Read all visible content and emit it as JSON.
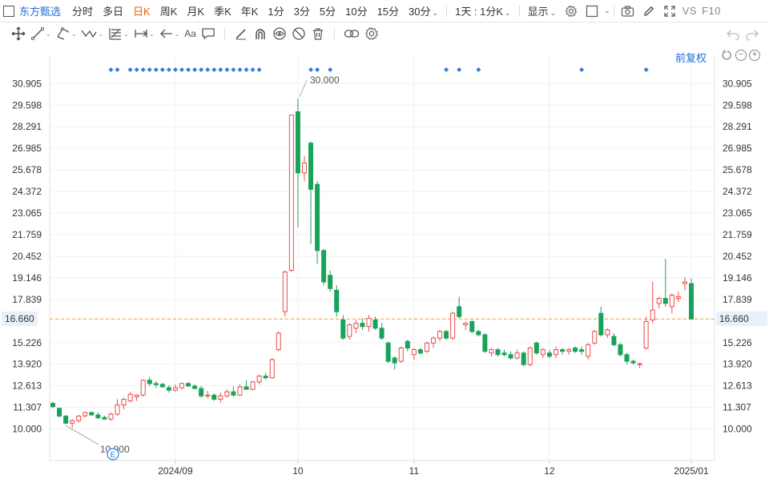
{
  "topbar": {
    "stock_name": "东方甄选",
    "periods": [
      "分时",
      "多日",
      "日K",
      "周K",
      "月K",
      "季K",
      "年K",
      "1分",
      "3分",
      "5分",
      "10分",
      "15分",
      "30分"
    ],
    "active_period": "日K",
    "multi_select": "1天 : 1分K",
    "display_label": "显示",
    "vs_label": "VS",
    "f10_label": "F10"
  },
  "toolbar": {
    "text_tool": "Aa",
    "icons": [
      "crosshair-move-icon",
      "line-tool-icon",
      "channel-tool-icon",
      "wave-tool-icon",
      "fib-tool-icon",
      "measure-tool-icon",
      "arrow-tool-icon",
      "text-tool-icon",
      "comment-tool-icon",
      "pen-tool-icon",
      "magnet-icon",
      "eye-icon",
      "hide-icon",
      "trash-icon",
      "link-icon",
      "settings-icon",
      "undo-icon",
      "redo-icon"
    ]
  },
  "chart_controls": {
    "adjust_label": "前复权"
  },
  "chart_data": {
    "type": "candlestick",
    "y_ticks": [
      "30.905",
      "29.598",
      "28.291",
      "26.985",
      "25.678",
      "24.372",
      "23.065",
      "21.759",
      "20.452",
      "19.146",
      "17.839",
      "16.660",
      "15.226",
      "13.920",
      "12.613",
      "11.307",
      "10.000"
    ],
    "ylim": [
      9.35,
      31.55
    ],
    "x_labels": [
      "2024/09",
      "10",
      "11",
      "12",
      "2025/01"
    ],
    "current_price": "16.660",
    "max_label": "30.000",
    "min_label": "10.900",
    "event_marker": "E",
    "colors": {
      "up": "#ee4b4b",
      "down": "#19a35a",
      "price_line": "#f2a13c",
      "dots": "#2f7ee5",
      "grid": "#f0f0f0"
    },
    "candles": [
      {
        "d": "2024-08-06",
        "o": 11.55,
        "h": 11.65,
        "l": 11.25,
        "c": 11.35
      },
      {
        "d": "2024-08-07",
        "o": 11.25,
        "h": 11.3,
        "l": 10.7,
        "c": 10.78
      },
      {
        "d": "2024-08-08",
        "o": 10.78,
        "h": 10.85,
        "l": 10.3,
        "c": 10.35
      },
      {
        "d": "2024-08-09",
        "o": 10.35,
        "h": 10.6,
        "l": 10.05,
        "c": 10.5
      },
      {
        "d": "2024-08-12",
        "o": 10.5,
        "h": 10.85,
        "l": 10.4,
        "c": 10.78
      },
      {
        "d": "2024-08-13",
        "o": 10.8,
        "h": 11.05,
        "l": 10.7,
        "c": 11.0
      },
      {
        "d": "2024-08-14",
        "o": 11.0,
        "h": 11.05,
        "l": 10.8,
        "c": 10.85
      },
      {
        "d": "2024-08-15",
        "o": 10.85,
        "h": 11.0,
        "l": 10.6,
        "c": 10.68
      },
      {
        "d": "2024-08-16",
        "o": 10.7,
        "h": 10.8,
        "l": 10.55,
        "c": 10.6
      },
      {
        "d": "2024-08-19",
        "o": 10.6,
        "h": 11.0,
        "l": 10.5,
        "c": 10.9
      },
      {
        "d": "2024-08-20",
        "o": 10.9,
        "h": 11.8,
        "l": 10.8,
        "c": 11.45
      },
      {
        "d": "2024-08-21",
        "o": 11.45,
        "h": 11.9,
        "l": 11.2,
        "c": 11.8
      },
      {
        "d": "2024-08-22",
        "o": 11.7,
        "h": 12.25,
        "l": 11.6,
        "c": 12.1
      },
      {
        "d": "2024-08-23",
        "o": 11.95,
        "h": 12.1,
        "l": 11.7,
        "c": 12.05
      },
      {
        "d": "2024-08-26",
        "o": 12.05,
        "h": 13.0,
        "l": 11.95,
        "c": 12.95
      },
      {
        "d": "2024-08-27",
        "o": 12.95,
        "h": 13.15,
        "l": 12.6,
        "c": 12.75
      },
      {
        "d": "2024-08-28",
        "o": 12.75,
        "h": 12.9,
        "l": 12.5,
        "c": 12.68
      },
      {
        "d": "2024-08-29",
        "o": 12.7,
        "h": 12.8,
        "l": 12.5,
        "c": 12.55
      },
      {
        "d": "2024-08-30",
        "o": 12.5,
        "h": 12.65,
        "l": 12.2,
        "c": 12.35
      },
      {
        "d": "2024-09-02",
        "o": 12.35,
        "h": 12.7,
        "l": 12.25,
        "c": 12.5
      },
      {
        "d": "2024-09-03",
        "o": 12.5,
        "h": 12.8,
        "l": 12.4,
        "c": 12.75
      },
      {
        "d": "2024-09-04",
        "o": 12.75,
        "h": 12.85,
        "l": 12.55,
        "c": 12.6
      },
      {
        "d": "2024-09-05",
        "o": 12.6,
        "h": 12.7,
        "l": 12.4,
        "c": 12.45
      },
      {
        "d": "2024-09-06",
        "o": 12.45,
        "h": 12.6,
        "l": 11.9,
        "c": 12.0
      },
      {
        "d": "2024-09-09",
        "o": 12.0,
        "h": 12.3,
        "l": 11.85,
        "c": 12.05
      },
      {
        "d": "2024-09-10",
        "o": 12.05,
        "h": 12.15,
        "l": 11.7,
        "c": 11.8
      },
      {
        "d": "2024-09-11",
        "o": 11.8,
        "h": 12.2,
        "l": 11.6,
        "c": 12.0
      },
      {
        "d": "2024-09-12",
        "o": 12.0,
        "h": 12.4,
        "l": 11.9,
        "c": 12.25
      },
      {
        "d": "2024-09-13",
        "o": 12.25,
        "h": 12.6,
        "l": 11.95,
        "c": 12.05
      },
      {
        "d": "2024-09-18",
        "o": 12.05,
        "h": 12.7,
        "l": 12.0,
        "c": 12.55
      },
      {
        "d": "2024-09-19",
        "o": 12.55,
        "h": 12.95,
        "l": 12.45,
        "c": 12.4
      },
      {
        "d": "2024-09-20",
        "o": 12.4,
        "h": 12.9,
        "l": 12.35,
        "c": 12.85
      },
      {
        "d": "2024-09-23",
        "o": 12.85,
        "h": 13.3,
        "l": 12.7,
        "c": 13.2
      },
      {
        "d": "2024-09-24",
        "o": 13.2,
        "h": 13.4,
        "l": 13.0,
        "c": 13.1
      },
      {
        "d": "2024-09-25",
        "o": 13.1,
        "h": 14.3,
        "l": 13.05,
        "c": 14.2
      },
      {
        "d": "2024-09-26",
        "o": 14.8,
        "h": 15.9,
        "l": 14.7,
        "c": 15.8
      },
      {
        "d": "2024-09-27",
        "o": 17.1,
        "h": 19.6,
        "l": 16.8,
        "c": 19.5
      },
      {
        "d": "2024-09-30",
        "o": 19.6,
        "h": 29.0,
        "l": 19.5,
        "c": 29.0
      },
      {
        "d": "2024-10-08",
        "o": 29.2,
        "h": 30.0,
        "l": 22.2,
        "c": 25.5
      },
      {
        "d": "2024-10-09",
        "o": 25.5,
        "h": 26.5,
        "l": 25.0,
        "c": 26.1
      },
      {
        "d": "2024-10-10",
        "o": 27.3,
        "h": 27.4,
        "l": 21.2,
        "c": 24.5
      },
      {
        "d": "2024-10-11",
        "o": 24.8,
        "h": 25.0,
        "l": 20.0,
        "c": 20.8
      },
      {
        "d": "2024-10-14",
        "o": 20.8,
        "h": 20.9,
        "l": 18.7,
        "c": 18.9
      },
      {
        "d": "2024-10-15",
        "o": 19.3,
        "h": 19.6,
        "l": 18.3,
        "c": 18.5
      },
      {
        "d": "2024-10-16",
        "o": 18.4,
        "h": 18.7,
        "l": 16.8,
        "c": 17.1
      },
      {
        "d": "2024-10-17",
        "o": 16.6,
        "h": 16.9,
        "l": 15.4,
        "c": 15.5
      },
      {
        "d": "2024-10-18",
        "o": 15.6,
        "h": 16.4,
        "l": 15.4,
        "c": 16.3
      },
      {
        "d": "2024-10-21",
        "o": 16.1,
        "h": 16.6,
        "l": 15.8,
        "c": 16.4
      },
      {
        "d": "2024-10-22",
        "o": 16.4,
        "h": 16.7,
        "l": 16.0,
        "c": 16.2
      },
      {
        "d": "2024-10-23",
        "o": 16.2,
        "h": 16.9,
        "l": 15.9,
        "c": 16.7
      },
      {
        "d": "2024-10-24",
        "o": 16.6,
        "h": 16.8,
        "l": 16.0,
        "c": 16.1
      },
      {
        "d": "2024-10-25",
        "o": 16.1,
        "h": 16.4,
        "l": 15.4,
        "c": 15.5
      },
      {
        "d": "2024-10-28",
        "o": 15.2,
        "h": 15.3,
        "l": 14.0,
        "c": 14.1
      },
      {
        "d": "2024-10-29",
        "o": 14.3,
        "h": 14.4,
        "l": 13.6,
        "c": 14.0
      },
      {
        "d": "2024-10-30",
        "o": 14.1,
        "h": 15.0,
        "l": 14.0,
        "c": 14.9
      },
      {
        "d": "2024-10-31",
        "o": 15.3,
        "h": 15.4,
        "l": 14.7,
        "c": 14.9
      },
      {
        "d": "2024-11-01",
        "o": 14.5,
        "h": 14.9,
        "l": 14.2,
        "c": 14.8
      },
      {
        "d": "2024-11-04",
        "o": 14.8,
        "h": 14.9,
        "l": 14.5,
        "c": 14.6
      },
      {
        "d": "2024-11-05",
        "o": 14.7,
        "h": 15.3,
        "l": 14.6,
        "c": 15.2
      },
      {
        "d": "2024-11-06",
        "o": 15.2,
        "h": 15.6,
        "l": 14.9,
        "c": 15.5
      },
      {
        "d": "2024-11-07",
        "o": 15.5,
        "h": 16.0,
        "l": 15.3,
        "c": 15.9
      },
      {
        "d": "2024-11-08",
        "o": 15.9,
        "h": 16.0,
        "l": 15.4,
        "c": 15.5
      },
      {
        "d": "2024-11-11",
        "o": 15.5,
        "h": 17.1,
        "l": 15.4,
        "c": 17.0
      },
      {
        "d": "2024-11-12",
        "o": 17.4,
        "h": 18.0,
        "l": 16.7,
        "c": 16.8
      },
      {
        "d": "2024-11-13",
        "o": 16.3,
        "h": 16.5,
        "l": 16.0,
        "c": 16.4
      },
      {
        "d": "2024-11-14",
        "o": 16.5,
        "h": 16.6,
        "l": 15.8,
        "c": 15.9
      },
      {
        "d": "2024-11-15",
        "o": 15.9,
        "h": 16.0,
        "l": 15.6,
        "c": 15.7
      },
      {
        "d": "2024-11-18",
        "o": 15.7,
        "h": 15.8,
        "l": 14.6,
        "c": 14.7
      },
      {
        "d": "2024-11-19",
        "o": 14.6,
        "h": 14.9,
        "l": 14.4,
        "c": 14.8
      },
      {
        "d": "2024-11-20",
        "o": 14.8,
        "h": 14.9,
        "l": 14.4,
        "c": 14.5
      },
      {
        "d": "2024-11-21",
        "o": 14.6,
        "h": 14.8,
        "l": 14.4,
        "c": 14.5
      },
      {
        "d": "2024-11-22",
        "o": 14.5,
        "h": 14.7,
        "l": 14.2,
        "c": 14.3
      },
      {
        "d": "2024-11-25",
        "o": 14.3,
        "h": 14.8,
        "l": 14.2,
        "c": 14.6
      },
      {
        "d": "2024-11-26",
        "o": 14.6,
        "h": 14.7,
        "l": 13.8,
        "c": 13.9
      },
      {
        "d": "2024-11-27",
        "o": 13.9,
        "h": 15.0,
        "l": 13.8,
        "c": 14.9
      },
      {
        "d": "2024-11-28",
        "o": 15.2,
        "h": 15.3,
        "l": 14.5,
        "c": 14.6
      },
      {
        "d": "2024-11-29",
        "o": 14.5,
        "h": 14.9,
        "l": 14.3,
        "c": 14.8
      },
      {
        "d": "2024-12-02",
        "o": 14.6,
        "h": 14.8,
        "l": 14.3,
        "c": 14.4
      },
      {
        "d": "2024-12-03",
        "o": 14.5,
        "h": 15.0,
        "l": 14.3,
        "c": 14.8
      },
      {
        "d": "2024-12-04",
        "o": 14.8,
        "h": 14.9,
        "l": 14.5,
        "c": 14.7
      },
      {
        "d": "2024-12-05",
        "o": 14.7,
        "h": 14.9,
        "l": 14.5,
        "c": 14.8
      },
      {
        "d": "2024-12-06",
        "o": 14.9,
        "h": 15.0,
        "l": 14.6,
        "c": 14.7
      },
      {
        "d": "2024-12-09",
        "o": 14.8,
        "h": 15.0,
        "l": 14.5,
        "c": 14.7
      },
      {
        "d": "2024-12-10",
        "o": 14.4,
        "h": 15.2,
        "l": 14.2,
        "c": 15.1
      },
      {
        "d": "2024-12-11",
        "o": 15.2,
        "h": 16.0,
        "l": 15.1,
        "c": 15.9
      },
      {
        "d": "2024-12-12",
        "o": 17.0,
        "h": 17.4,
        "l": 15.6,
        "c": 15.7
      },
      {
        "d": "2024-12-13",
        "o": 15.7,
        "h": 16.1,
        "l": 15.5,
        "c": 16.0
      },
      {
        "d": "2024-12-16",
        "o": 15.6,
        "h": 15.8,
        "l": 15.0,
        "c": 15.1
      },
      {
        "d": "2024-12-17",
        "o": 15.1,
        "h": 15.2,
        "l": 14.4,
        "c": 14.5
      },
      {
        "d": "2024-12-18",
        "o": 14.5,
        "h": 14.6,
        "l": 13.9,
        "c": 14.1
      },
      {
        "d": "2024-12-19",
        "o": 14.1,
        "h": 14.2,
        "l": 13.9,
        "c": 14.0
      },
      {
        "d": "2024-12-20",
        "o": 13.9,
        "h": 14.0,
        "l": 13.7,
        "c": 13.95
      },
      {
        "d": "2024-12-23",
        "o": 14.9,
        "h": 16.8,
        "l": 14.8,
        "c": 16.5
      },
      {
        "d": "2024-12-24",
        "o": 16.6,
        "h": 18.9,
        "l": 16.4,
        "c": 17.2
      },
      {
        "d": "2024-12-25",
        "o": 17.6,
        "h": 18.0,
        "l": 17.3,
        "c": 17.9
      },
      {
        "d": "2024-12-26",
        "o": 17.9,
        "h": 20.3,
        "l": 17.4,
        "c": 17.6
      },
      {
        "d": "2024-12-27",
        "o": 17.4,
        "h": 18.2,
        "l": 17.0,
        "c": 18.1
      },
      {
        "d": "2024-12-30",
        "o": 17.9,
        "h": 18.3,
        "l": 17.7,
        "c": 18.0
      },
      {
        "d": "2024-12-31",
        "o": 18.8,
        "h": 19.2,
        "l": 18.4,
        "c": 18.9
      },
      {
        "d": "2025-01-02",
        "o": 18.8,
        "h": 19.1,
        "l": 16.6,
        "c": 16.66
      }
    ],
    "event_dots_on": [
      "2024-08-19",
      "2024-08-20",
      "2024-08-22",
      "2024-08-23",
      "2024-08-26",
      "2024-08-27",
      "2024-08-28",
      "2024-08-29",
      "2024-08-30",
      "2024-09-02",
      "2024-09-03",
      "2024-09-04",
      "2024-09-05",
      "2024-09-06",
      "2024-09-09",
      "2024-09-10",
      "2024-09-11",
      "2024-09-12",
      "2024-09-13",
      "2024-09-18",
      "2024-09-19",
      "2024-09-20",
      "2024-09-23",
      "2024-10-10",
      "2024-10-11",
      "2024-10-15",
      "2024-11-08",
      "2024-11-12",
      "2024-11-15",
      "2024-12-09",
      "2024-12-23"
    ]
  }
}
